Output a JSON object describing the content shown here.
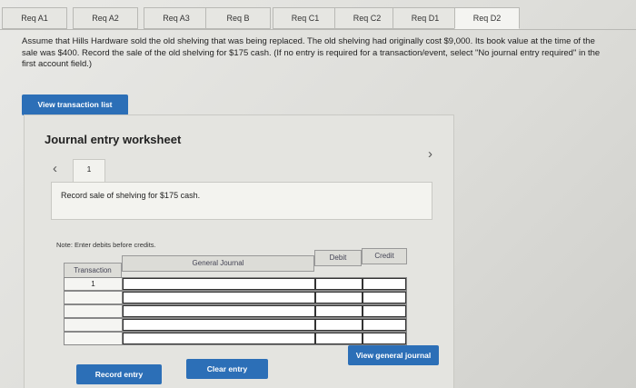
{
  "tabs": [
    {
      "label": "Req A1"
    },
    {
      "label": "Req A2"
    },
    {
      "label": "Req A3"
    },
    {
      "label": "Req B"
    },
    {
      "label": "Req C1"
    },
    {
      "label": "Req C2"
    },
    {
      "label": "Req D1"
    },
    {
      "label": "Req D2"
    }
  ],
  "instructions": "Assume that Hills Hardware sold the old shelving that was being replaced. The old shelving had originally cost $9,000. Its book value at the time of the sale was $400. Record the sale of the old shelving for $175 cash. (If no entry is required for a transaction/event, select \"No journal entry required\" in the first account field.)",
  "view_transaction_list_label": "View transaction list",
  "worksheet": {
    "title": "Journal entry worksheet",
    "page_number": "1",
    "description": "Record sale of shelving for $175 cash.",
    "note": "Note: Enter debits before credits.",
    "columns": {
      "transaction": "Transaction",
      "account": "General Journal",
      "debit": "Debit",
      "credit": "Credit"
    },
    "rows": [
      {
        "transaction": "1"
      },
      {
        "transaction": ""
      },
      {
        "transaction": ""
      },
      {
        "transaction": ""
      },
      {
        "transaction": ""
      },
      {
        "transaction": ""
      }
    ]
  },
  "buttons": {
    "record_entry": "Record entry",
    "clear_entry": "Clear entry",
    "view_general_journal": "View general journal"
  },
  "icons": {
    "prev": "chevron-left-icon",
    "next": "chevron-right-icon"
  }
}
